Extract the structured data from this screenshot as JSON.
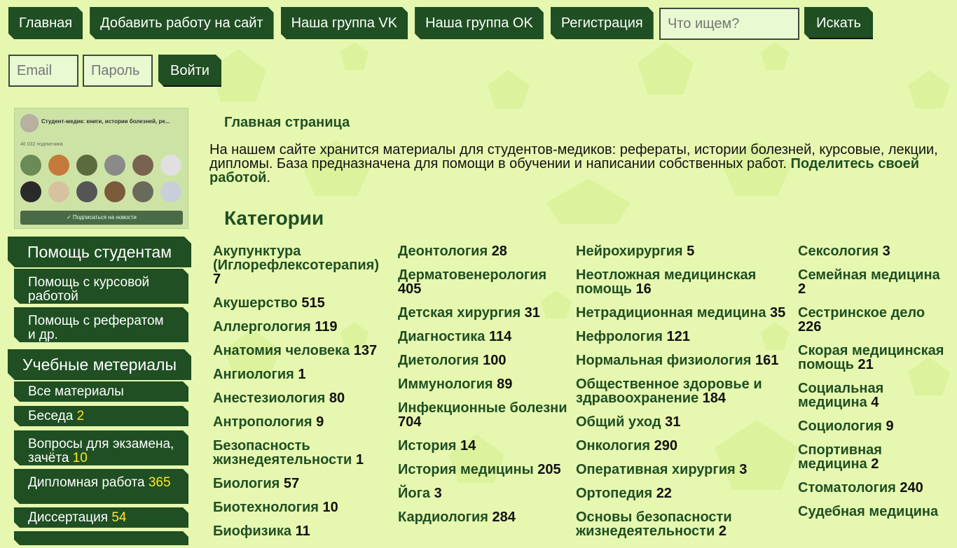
{
  "nav": {
    "items": [
      "Главная",
      "Добавить работу на сайт",
      "Наша группа VK",
      "Наша группа OK",
      "Регистрация"
    ],
    "search_placeholder": "Что ищем?",
    "search_button": "Искать"
  },
  "login": {
    "email_placeholder": "Email",
    "password_placeholder": "Пароль",
    "button": "Войти"
  },
  "vk_widget": {
    "title": "Студент-медик: книги, истории болезней, ре...",
    "subscribers": "46 032 подписчика",
    "subscribe_button": "Подписаться на новости"
  },
  "sidebar": {
    "help_title": "Помощь студентам",
    "help_items": [
      "Помощь с курсовой работой",
      "Помощь с рефератом и др."
    ],
    "materials_title": "Учебные метериалы",
    "material_items": [
      {
        "label": "Все материалы",
        "count": ""
      },
      {
        "label": "Беседа",
        "count": "2"
      },
      {
        "label": "Вопросы для экзамена, зачёта",
        "count": "10"
      },
      {
        "label": "Дипломная работа",
        "count": "365"
      },
      {
        "label": "Диссертация",
        "count": "54"
      }
    ]
  },
  "main": {
    "breadcrumb": "Главная страница",
    "intro_text": "На нашем сайте хранится материалы для студентов-медиков: рефераты, истории болезней, курсовые, лекции, дипломы. База предназначена для помощи в обучении и написании собственных работ.",
    "intro_link": "Поделитесь своей работой",
    "intro_end": ".",
    "categories_title": "Категории"
  },
  "categories": [
    [
      {
        "name": "Акупунктура (Иглорефлексотерапия)",
        "count": "7"
      },
      {
        "name": "Акушерство",
        "count": "515"
      },
      {
        "name": "Аллергология",
        "count": "119"
      },
      {
        "name": "Анатомия человека",
        "count": "137"
      },
      {
        "name": "Ангиология",
        "count": "1"
      },
      {
        "name": "Анестезиология",
        "count": "80"
      },
      {
        "name": "Антропология",
        "count": "9"
      },
      {
        "name": "Безопасность жизнедеятельности",
        "count": "1"
      },
      {
        "name": "Биология",
        "count": "57"
      },
      {
        "name": "Биотехнология",
        "count": "10"
      },
      {
        "name": "Биофизика",
        "count": "11"
      }
    ],
    [
      {
        "name": "Деонтология",
        "count": "28"
      },
      {
        "name": "Дерматовенерология",
        "count": "405"
      },
      {
        "name": "Детская хирургия",
        "count": "31"
      },
      {
        "name": "Диагностика",
        "count": "114"
      },
      {
        "name": "Диетология",
        "count": "100"
      },
      {
        "name": "Иммунология",
        "count": "89"
      },
      {
        "name": "Инфекционные болезни",
        "count": "704"
      },
      {
        "name": "История",
        "count": "14"
      },
      {
        "name": "История медицины",
        "count": "205"
      },
      {
        "name": "Йога",
        "count": "3"
      },
      {
        "name": "Кардиология",
        "count": "284"
      }
    ],
    [
      {
        "name": "Нейрохирургия",
        "count": "5"
      },
      {
        "name": "Неотложная медицинская помощь",
        "count": "16"
      },
      {
        "name": "Нетрадиционная медицина",
        "count": "35"
      },
      {
        "name": "Нефрология",
        "count": "121"
      },
      {
        "name": "Нормальная физиология",
        "count": "161"
      },
      {
        "name": "Общественное здоровье и здравоохранение",
        "count": "184"
      },
      {
        "name": "Общий уход",
        "count": "31"
      },
      {
        "name": "Онкология",
        "count": "290"
      },
      {
        "name": "Оперативная хирургия",
        "count": "3"
      },
      {
        "name": "Ортопедия",
        "count": "22"
      },
      {
        "name": "Основы безопасности жизнедеятельности",
        "count": "2"
      }
    ],
    [
      {
        "name": "Сексология",
        "count": "3"
      },
      {
        "name": "Семейная медицина",
        "count": "2"
      },
      {
        "name": "Сестринское дело",
        "count": "226"
      },
      {
        "name": "Скорая медицинская помощь",
        "count": "21"
      },
      {
        "name": "Социальная медицина",
        "count": "4"
      },
      {
        "name": "Социология",
        "count": "9"
      },
      {
        "name": "Спортивная медицина",
        "count": "2"
      },
      {
        "name": "Стоматология",
        "count": "240"
      },
      {
        "name": "Судебная медицина",
        "count": ""
      }
    ]
  ],
  "colors": {
    "accent": "#1f4f22",
    "background": "#e6f7b0",
    "highlight": "#ffe533"
  }
}
